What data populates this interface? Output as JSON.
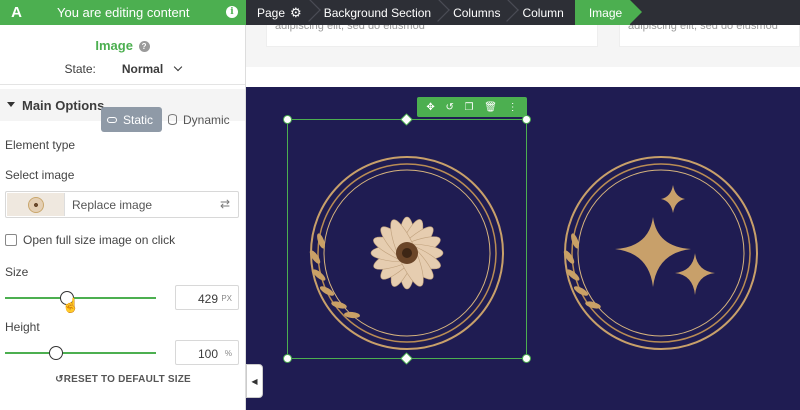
{
  "topbar": {
    "logo": "A",
    "editing_label": "You are editing content",
    "info_icon": "info-icon",
    "breadcrumbs": [
      "Page",
      "Background Section",
      "Columns",
      "Column",
      "Image"
    ]
  },
  "panel": {
    "title": "Image",
    "state_label": "State:",
    "state_value": "Normal",
    "section_title": "Main Options",
    "element_type_label": "Element type",
    "element_type_static": "Static",
    "element_type_dynamic": "Dynamic",
    "select_image_label": "Select image",
    "replace_image": "Replace image",
    "open_full_size_label": "Open full size image on click",
    "size_label": "Size",
    "size_value": "429",
    "size_unit": "PX",
    "height_label": "Height",
    "height_value": "100",
    "height_unit": "%",
    "reset_label": "RESET TO DEFAULT SIZE"
  },
  "canvas": {
    "card_text_left": "adipiscing elit, sed do eiusmod",
    "card_text_right": "adipiscing elit, sed do eiusmod",
    "hero_bg": "#1f1c52",
    "gold": "#c8a06a",
    "accent": "#4caf50"
  }
}
